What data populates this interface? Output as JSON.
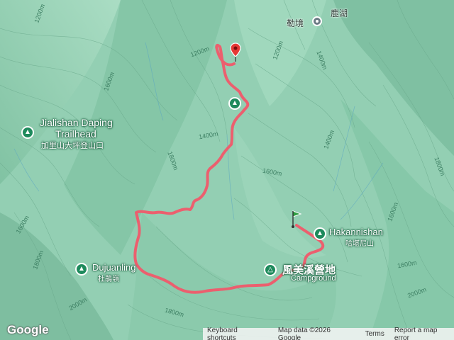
{
  "places": {
    "lujing": "勒境",
    "luhu": "鹿湖",
    "jialishan_en_1": "Jialishan Daping",
    "jialishan_en_2": "Trailhead",
    "jialishan_zh": "加里山大坪登山口",
    "dujuanling_en": "Dujuanling",
    "dujuanling_zh": "杜鵑嶺",
    "hakannishan_en": "Hakannishan",
    "hakannishan_zh": "哈堪尼山",
    "campground_zh": "風美溪營地",
    "campground_en": "Campground"
  },
  "contours": {
    "c1": "1200m",
    "c2": "1200m",
    "c3": "1400m",
    "c4": "1600m",
    "c5": "1400m",
    "c6": "1600m",
    "c7": "1800m",
    "c8": "1600m",
    "c9": "1800m",
    "c10": "2000m",
    "c11": "1200m",
    "c12": "1600m",
    "c13": "1400m",
    "c14": "1600m",
    "c15": "1800m",
    "c16": "1800m",
    "c17": "2000m"
  },
  "footer": {
    "keyboard": "Keyboard shortcuts",
    "mapdata": "Map data ©2026 Google",
    "terms": "Terms",
    "report": "Report a map error"
  },
  "logo": "Google",
  "colors": {
    "route": "#f0596a",
    "terrain": "#8fcdb0",
    "poi": "#1e8a5c",
    "end_marker": "#e53935",
    "start_marker": "#2ea043"
  },
  "icons": {
    "poi": "hiker-icon",
    "camp": "campsite-icon",
    "city": "city-icon"
  }
}
